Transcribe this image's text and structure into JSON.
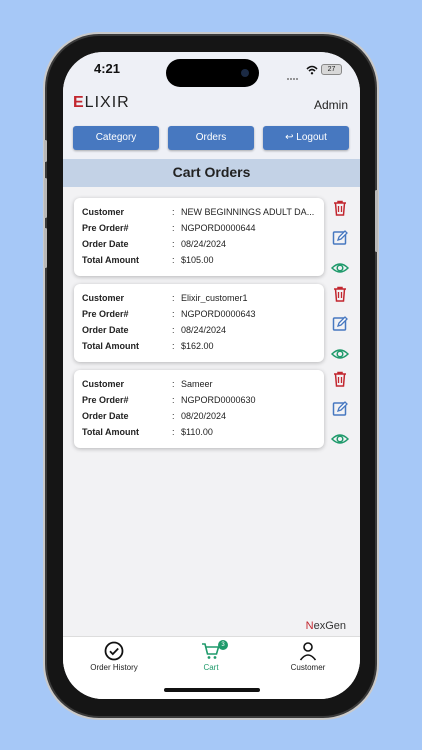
{
  "status": {
    "time": "4:21",
    "battery": "27"
  },
  "header": {
    "logo_first": "E",
    "logo_rest": "LIXIR",
    "user": "Admin"
  },
  "nav": {
    "category": "Category",
    "orders": "Orders",
    "logout": "Logout"
  },
  "page_title": "Cart Orders",
  "labels": {
    "customer": "Customer",
    "preorder": "Pre Order#",
    "date": "Order Date",
    "amount": "Total Amount",
    "colon": ":"
  },
  "orders": [
    {
      "customer": "NEW BEGINNINGS ADULT DA...",
      "preorder": "NGPORD0000644",
      "date": "08/24/2024",
      "amount": "$105.00"
    },
    {
      "customer": "Elixir_customer1",
      "preorder": "NGPORD0000643",
      "date": "08/24/2024",
      "amount": "$162.00"
    },
    {
      "customer": "Sameer",
      "preorder": "NGPORD0000630",
      "date": "08/20/2024",
      "amount": "$110.00"
    }
  ],
  "brand": {
    "n": "N",
    "rest": "exGen"
  },
  "tabs": {
    "history": "Order History",
    "cart": "Cart",
    "cart_badge": "3",
    "customer": "Customer"
  },
  "colors": {
    "primary": "#4778c0",
    "danger": "#c2262e",
    "accent": "#1f9a6b"
  },
  "icons": {
    "delete": "trash-icon",
    "edit": "edit-icon",
    "view": "eye-icon"
  }
}
